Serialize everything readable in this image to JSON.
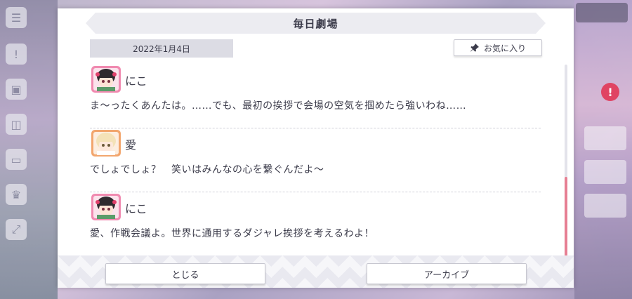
{
  "dialog": {
    "title": "毎日劇場",
    "date": "2022年1月4日",
    "favorite_label": "お気に入り",
    "close_label": "とじる",
    "archive_label": "アーカイブ"
  },
  "entries": [
    {
      "speaker": "にこ",
      "text": "ま〜ったくあんたは。……でも、最初の挨拶で会場の空気を掴めたら強いわね……",
      "avatar": "nico-avatar"
    },
    {
      "speaker": "愛",
      "text": "でしょでしょ？　笑いはみんなの心を繋ぐんだよ〜",
      "avatar": "ai-avatar"
    },
    {
      "speaker": "にこ",
      "text": "愛、作戦会議よ。世界に通用するダジャレ挨拶を考えるわよ！",
      "avatar": "nico-avatar"
    }
  ],
  "colors": {
    "accent_scroll": "#e67f93",
    "text": "#3b3b4a",
    "panel_bg": "#ffffff"
  }
}
